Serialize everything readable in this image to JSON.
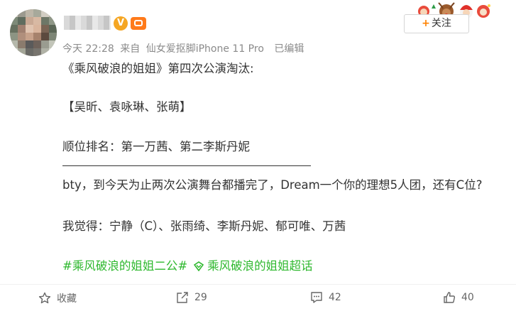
{
  "post": {
    "meta": {
      "time": "今天 22:28",
      "source_prefix": "来自",
      "source": "仙女爱抠脚iPhone 11 Pro",
      "edited": "已编辑"
    },
    "follow_button": {
      "plus": "+",
      "label": "关注"
    },
    "vip_badge": "V",
    "lines": [
      "《乘风破浪的姐姐》第四次公演淘汰:",
      "【吴昕、袁咏琳、张萌】",
      "顺位排名：第一万茜、第二李斯丹妮",
      "bty，到今天为止两次公演舞台都播完了，Dream一个你的理想5人团，还有C位?",
      "我觉得：宁静（C）、张雨绮、李斯丹妮、郁可唯、万茜"
    ],
    "hashtag": "#乘风破浪的姐姐二公#",
    "supertopic": "乘风破浪的姐姐超话"
  },
  "actions": {
    "favorite_label": "收藏",
    "repost_count": "29",
    "comment_count": "42",
    "like_count": "40"
  },
  "colors": {
    "tag_green": "#2eb82e",
    "follow_plus": "#ff8200",
    "vip": "#f5a623"
  }
}
